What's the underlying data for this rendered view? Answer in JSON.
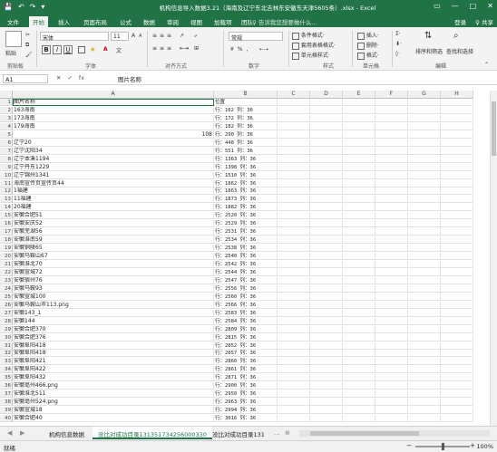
{
  "titlebar": {
    "title": "机构信息导入数据3.21（海南及辽宁东北吉林东安徽东天津5605条）.xlsx - Excel",
    "qat": [
      "💾",
      "↶",
      "↷",
      "▾"
    ],
    "win_buttons": [
      "▭",
      "—",
      "□",
      "✕"
    ]
  },
  "tabs": {
    "items": [
      "文件",
      "开始",
      "插入",
      "页面布局",
      "公式",
      "数据",
      "审阅",
      "视图",
      "加载项",
      "团队"
    ],
    "active": "开始",
    "search_placeholder": "♀ 告诉我您想要做什么...",
    "login": "登录",
    "share": "♀ 共享"
  },
  "ribbon": {
    "clipboard": {
      "paste": "粘贴",
      "label": "剪贴板"
    },
    "font": {
      "name": "宋体",
      "size": "11",
      "bold": "B",
      "italic": "I",
      "underline": "U",
      "grow": "A",
      "shrink": "A",
      "phonetic": "文",
      "label": "字体"
    },
    "alignment": {
      "label": "对齐方式"
    },
    "number": {
      "format": "常规",
      "label": "数字"
    },
    "styles": {
      "conditional": "条件格式·",
      "table": "套用表格格式·",
      "cell": "单元格样式·",
      "label": "样式"
    },
    "cells": {
      "insert": "插入·",
      "delete": "删除·",
      "format": "格式·",
      "label": "单元格"
    },
    "editing": {
      "sum": "Σ·",
      "sort": "排序和筛选",
      "find": "查找和选择",
      "label": "编辑"
    }
  },
  "formula_bar": {
    "name_box": "A1",
    "fx_symbols": [
      "✕",
      "✓",
      "fx"
    ],
    "content": "图片名称"
  },
  "columns": [
    "A",
    "B",
    "C",
    "D",
    "E",
    "F",
    "G",
    "H"
  ],
  "rows": [
    {
      "n": "1",
      "a": "图片名称",
      "b": "位置"
    },
    {
      "n": "2",
      "a": "163海南",
      "b": "行：162  列：36"
    },
    {
      "n": "3",
      "a": "173海南",
      "b": "行：172  列：36"
    },
    {
      "n": "4",
      "a": "179海南",
      "b": "行：182  列：36"
    },
    {
      "n": "5",
      "a": "108",
      "b": "行：290  列：36",
      "a_num": true
    },
    {
      "n": "6",
      "a": "辽宁20",
      "b": "行：448  列：36"
    },
    {
      "n": "7",
      "a": "辽宁沈阳34",
      "b": "行：551  列：36"
    },
    {
      "n": "8",
      "a": "辽宁本溪1194",
      "b": "行：1363  列：36"
    },
    {
      "n": "9",
      "a": "辽宁丹东1229",
      "b": "行：1398  列：36"
    },
    {
      "n": "10",
      "a": "辽宁锦州1341",
      "b": "行：1510  列：36"
    },
    {
      "n": "11",
      "a": "海南宣传页宣传页44",
      "b": "行：1862  列：36"
    },
    {
      "n": "12",
      "a": "1福建",
      "b": "行：1863  列：36"
    },
    {
      "n": "13",
      "a": "11福建",
      "b": "行：1873  列：36"
    },
    {
      "n": "14",
      "a": "20福建",
      "b": "行：1882  列：36"
    },
    {
      "n": "15",
      "a": "安徽合肥51",
      "b": "行：2520  列：36"
    },
    {
      "n": "16",
      "a": "安徽安庆52",
      "b": "行：2529  列：36"
    },
    {
      "n": "17",
      "a": "安徽芜湖56",
      "b": "行：2531  列：36"
    },
    {
      "n": "18",
      "a": "安徽淮南59",
      "b": "行：2534  列：36"
    },
    {
      "n": "19",
      "a": "安徽铜陵65",
      "b": "行：2538  列：36"
    },
    {
      "n": "20",
      "a": "安徽马鞍山67",
      "b": "行：2540  列：36"
    },
    {
      "n": "21",
      "a": "安徽淮北70",
      "b": "行：2542  列：36"
    },
    {
      "n": "22",
      "a": "安徽宣城72",
      "b": "行：2544  列：36"
    },
    {
      "n": "23",
      "a": "安徽宿州76",
      "b": "行：2547  列：36"
    },
    {
      "n": "24",
      "a": "安徽马鞍93",
      "b": "行：2556  列：36"
    },
    {
      "n": "25",
      "a": "安徽宣城100",
      "b": "行：2560  列：36"
    },
    {
      "n": "26",
      "a": "安徽马鞍山市113.png",
      "b": "行：2566  列：36"
    },
    {
      "n": "27",
      "a": "安徽143_1",
      "b": "行：2583  列：36"
    },
    {
      "n": "28",
      "a": "安徽144",
      "b": "行：2584  列：36"
    },
    {
      "n": "29",
      "a": "安徽合肥370",
      "b": "行：2809  列：36"
    },
    {
      "n": "30",
      "a": "安徽合肥376",
      "b": "行：2815  列：36"
    },
    {
      "n": "31",
      "a": "安徽阜阳418",
      "b": "行：2852  列：36"
    },
    {
      "n": "32",
      "a": "安徽阜阳418",
      "b": "行：2857  列：36"
    },
    {
      "n": "33",
      "a": "安徽阜阳421",
      "b": "行：2860  列：36"
    },
    {
      "n": "34",
      "a": "安徽阜阳422",
      "b": "行：2861  列：36"
    },
    {
      "n": "35",
      "a": "安徽阜阳432",
      "b": "行：2871  列：36"
    },
    {
      "n": "36",
      "a": "安徽亳州466.png",
      "b": "行：2900  列：36"
    },
    {
      "n": "37",
      "a": "安徽淮北511",
      "b": "行：2950  列：36"
    },
    {
      "n": "38",
      "a": "安徽亳州524.png",
      "b": "行：2963  列：36"
    },
    {
      "n": "39",
      "a": "安徽宣城18",
      "b": "行：2994  列：36"
    },
    {
      "n": "40",
      "a": "安徽合肥40",
      "b": "行：3016  列：36"
    }
  ],
  "sheet_tabs": {
    "arrows": [
      "◀",
      "▶"
    ],
    "items": [
      "机构信息数据",
      "没比对成功目录131351734256000330",
      "没比对成功目录131"
    ],
    "active_index": 1,
    "more": "...",
    "add": "⊕"
  },
  "status": {
    "ready": "就绪",
    "zoom": "100%",
    "zoom_minus": "−",
    "zoom_plus": "+"
  }
}
